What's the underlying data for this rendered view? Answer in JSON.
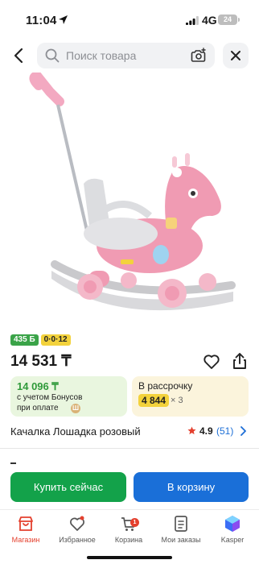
{
  "status_bar": {
    "time": "11:04",
    "network": "4G",
    "battery": "24"
  },
  "search": {
    "placeholder": "Поиск товара"
  },
  "product": {
    "image_alt": "rocking-horse-pink-product-photo",
    "badges": {
      "bonus": "435 Б",
      "installment": "0·0·12"
    },
    "price": "14 531 ₸",
    "bonus_card": {
      "amount": "14 096 ₸",
      "line1": "с учетом Бонусов",
      "line2": "при оплате",
      "coin_symbol": "Ш"
    },
    "installment_card": {
      "title": "В рассрочку",
      "monthly": "4 844",
      "multiplier": "× 3"
    },
    "name": "Качалка Лошадка розовый",
    "rating": "4.9",
    "reviews": "(51)"
  },
  "actions": {
    "buy_now": "Купить сейчас",
    "add_to_cart": "В корзину"
  },
  "bottom_nav": {
    "items": [
      {
        "label": "Магазин",
        "icon": "shop-icon"
      },
      {
        "label": "Избранное",
        "icon": "heart-icon"
      },
      {
        "label": "Корзина",
        "icon": "cart-icon",
        "badge": "1"
      },
      {
        "label": "Мои заказы",
        "icon": "orders-icon"
      },
      {
        "label": "Kasper",
        "icon": "kasper-assistant-icon"
      }
    ]
  },
  "colors": {
    "accent_red": "#e4402e",
    "buy_green": "#13a24a",
    "cart_blue": "#1a6fd8",
    "bonus_green": "#2f9a3a",
    "installment_yellow": "#f3d23c"
  }
}
